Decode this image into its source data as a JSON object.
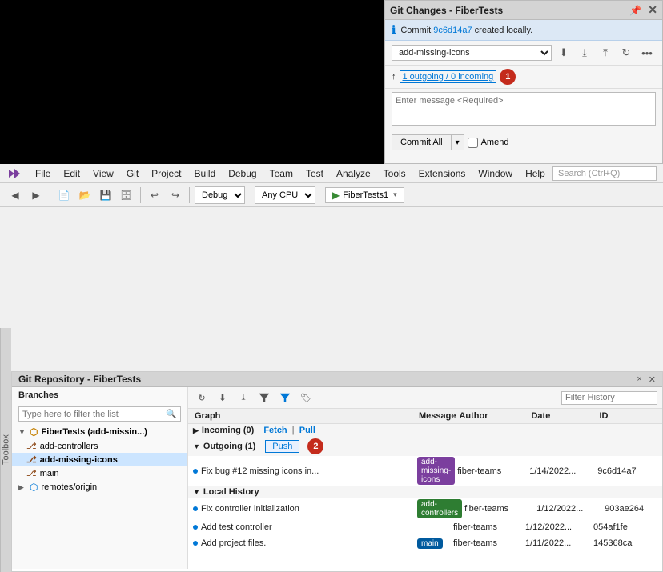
{
  "gitChanges": {
    "title": "Git Changes - FiberTests",
    "infoBar": {
      "commitId": "9c6d14a7",
      "message": " created locally."
    },
    "branchName": "add-missing-icons",
    "outgoingText": "1 outgoing / 0 incoming",
    "messageInputPlaceholder": "Enter message <Required>",
    "commitAllLabel": "Commit All",
    "amendLabel": "Amend",
    "circleNum": "1"
  },
  "menu": {
    "logo": "❖",
    "items": [
      "File",
      "Edit",
      "View",
      "Git",
      "Project",
      "Build",
      "Debug",
      "Team",
      "Test",
      "Analyze",
      "Tools",
      "Extensions",
      "Window",
      "Help"
    ]
  },
  "toolbar": {
    "debugLabel": "Debug",
    "cpuLabel": "Any CPU",
    "projectLabel": "FiberTests1"
  },
  "toolboxLabel": "Toolbox",
  "gitRepo": {
    "title": "Git Repository - FiberTests",
    "branchesLabel": "Branches",
    "filterPlaceholder": "Type here to filter the list",
    "treeItems": [
      {
        "label": "FiberTests (add-missin...)",
        "level": 1,
        "type": "branch",
        "expanded": true
      },
      {
        "label": "add-controllers",
        "level": 2,
        "type": "leaf"
      },
      {
        "label": "add-missing-icons",
        "level": 2,
        "type": "leaf",
        "selected": true
      },
      {
        "label": "main",
        "level": 2,
        "type": "leaf"
      },
      {
        "label": "remotes/origin",
        "level": 1,
        "type": "branch",
        "expanded": false
      }
    ],
    "tableHeaders": [
      "Graph",
      "Message",
      "Author",
      "Date",
      "ID"
    ],
    "sections": [
      {
        "type": "section",
        "label": "Incoming (0)",
        "children": [],
        "actions": [
          "Fetch",
          "Pull"
        ]
      },
      {
        "type": "section",
        "label": "Outgoing (1)",
        "children": [
          {
            "graphLabel": "●",
            "message": "Fix bug #12 missing icons in...",
            "tag": "add-missing-icons",
            "tagColor": "add-missing",
            "author": "fiber-teams",
            "date": "1/14/2022...",
            "id": "9c6d14a7"
          }
        ],
        "actions": [
          "Push"
        ],
        "actionHighlight": "Push"
      },
      {
        "type": "section",
        "label": "Local History",
        "children": [
          {
            "message": "Fix controller initialization",
            "tag": "add-controllers",
            "tagColor": "add-controllers",
            "author": "fiber-teams",
            "date": "1/12/2022...",
            "id": "903ae264"
          },
          {
            "message": "Add test controller",
            "tag": "",
            "tagColor": "",
            "author": "fiber-teams",
            "date": "1/12/2022...",
            "id": "054af1fe"
          },
          {
            "message": "Add project files.",
            "tag": "main",
            "tagColor": "main",
            "author": "fiber-teams",
            "date": "1/11/2022...",
            "id": "145368ca"
          }
        ]
      }
    ],
    "filterHistoryPlaceholder": "Filter History",
    "circleNum2": "2"
  },
  "searchBar": {
    "placeholder": "Search (Ctrl+Q)"
  }
}
